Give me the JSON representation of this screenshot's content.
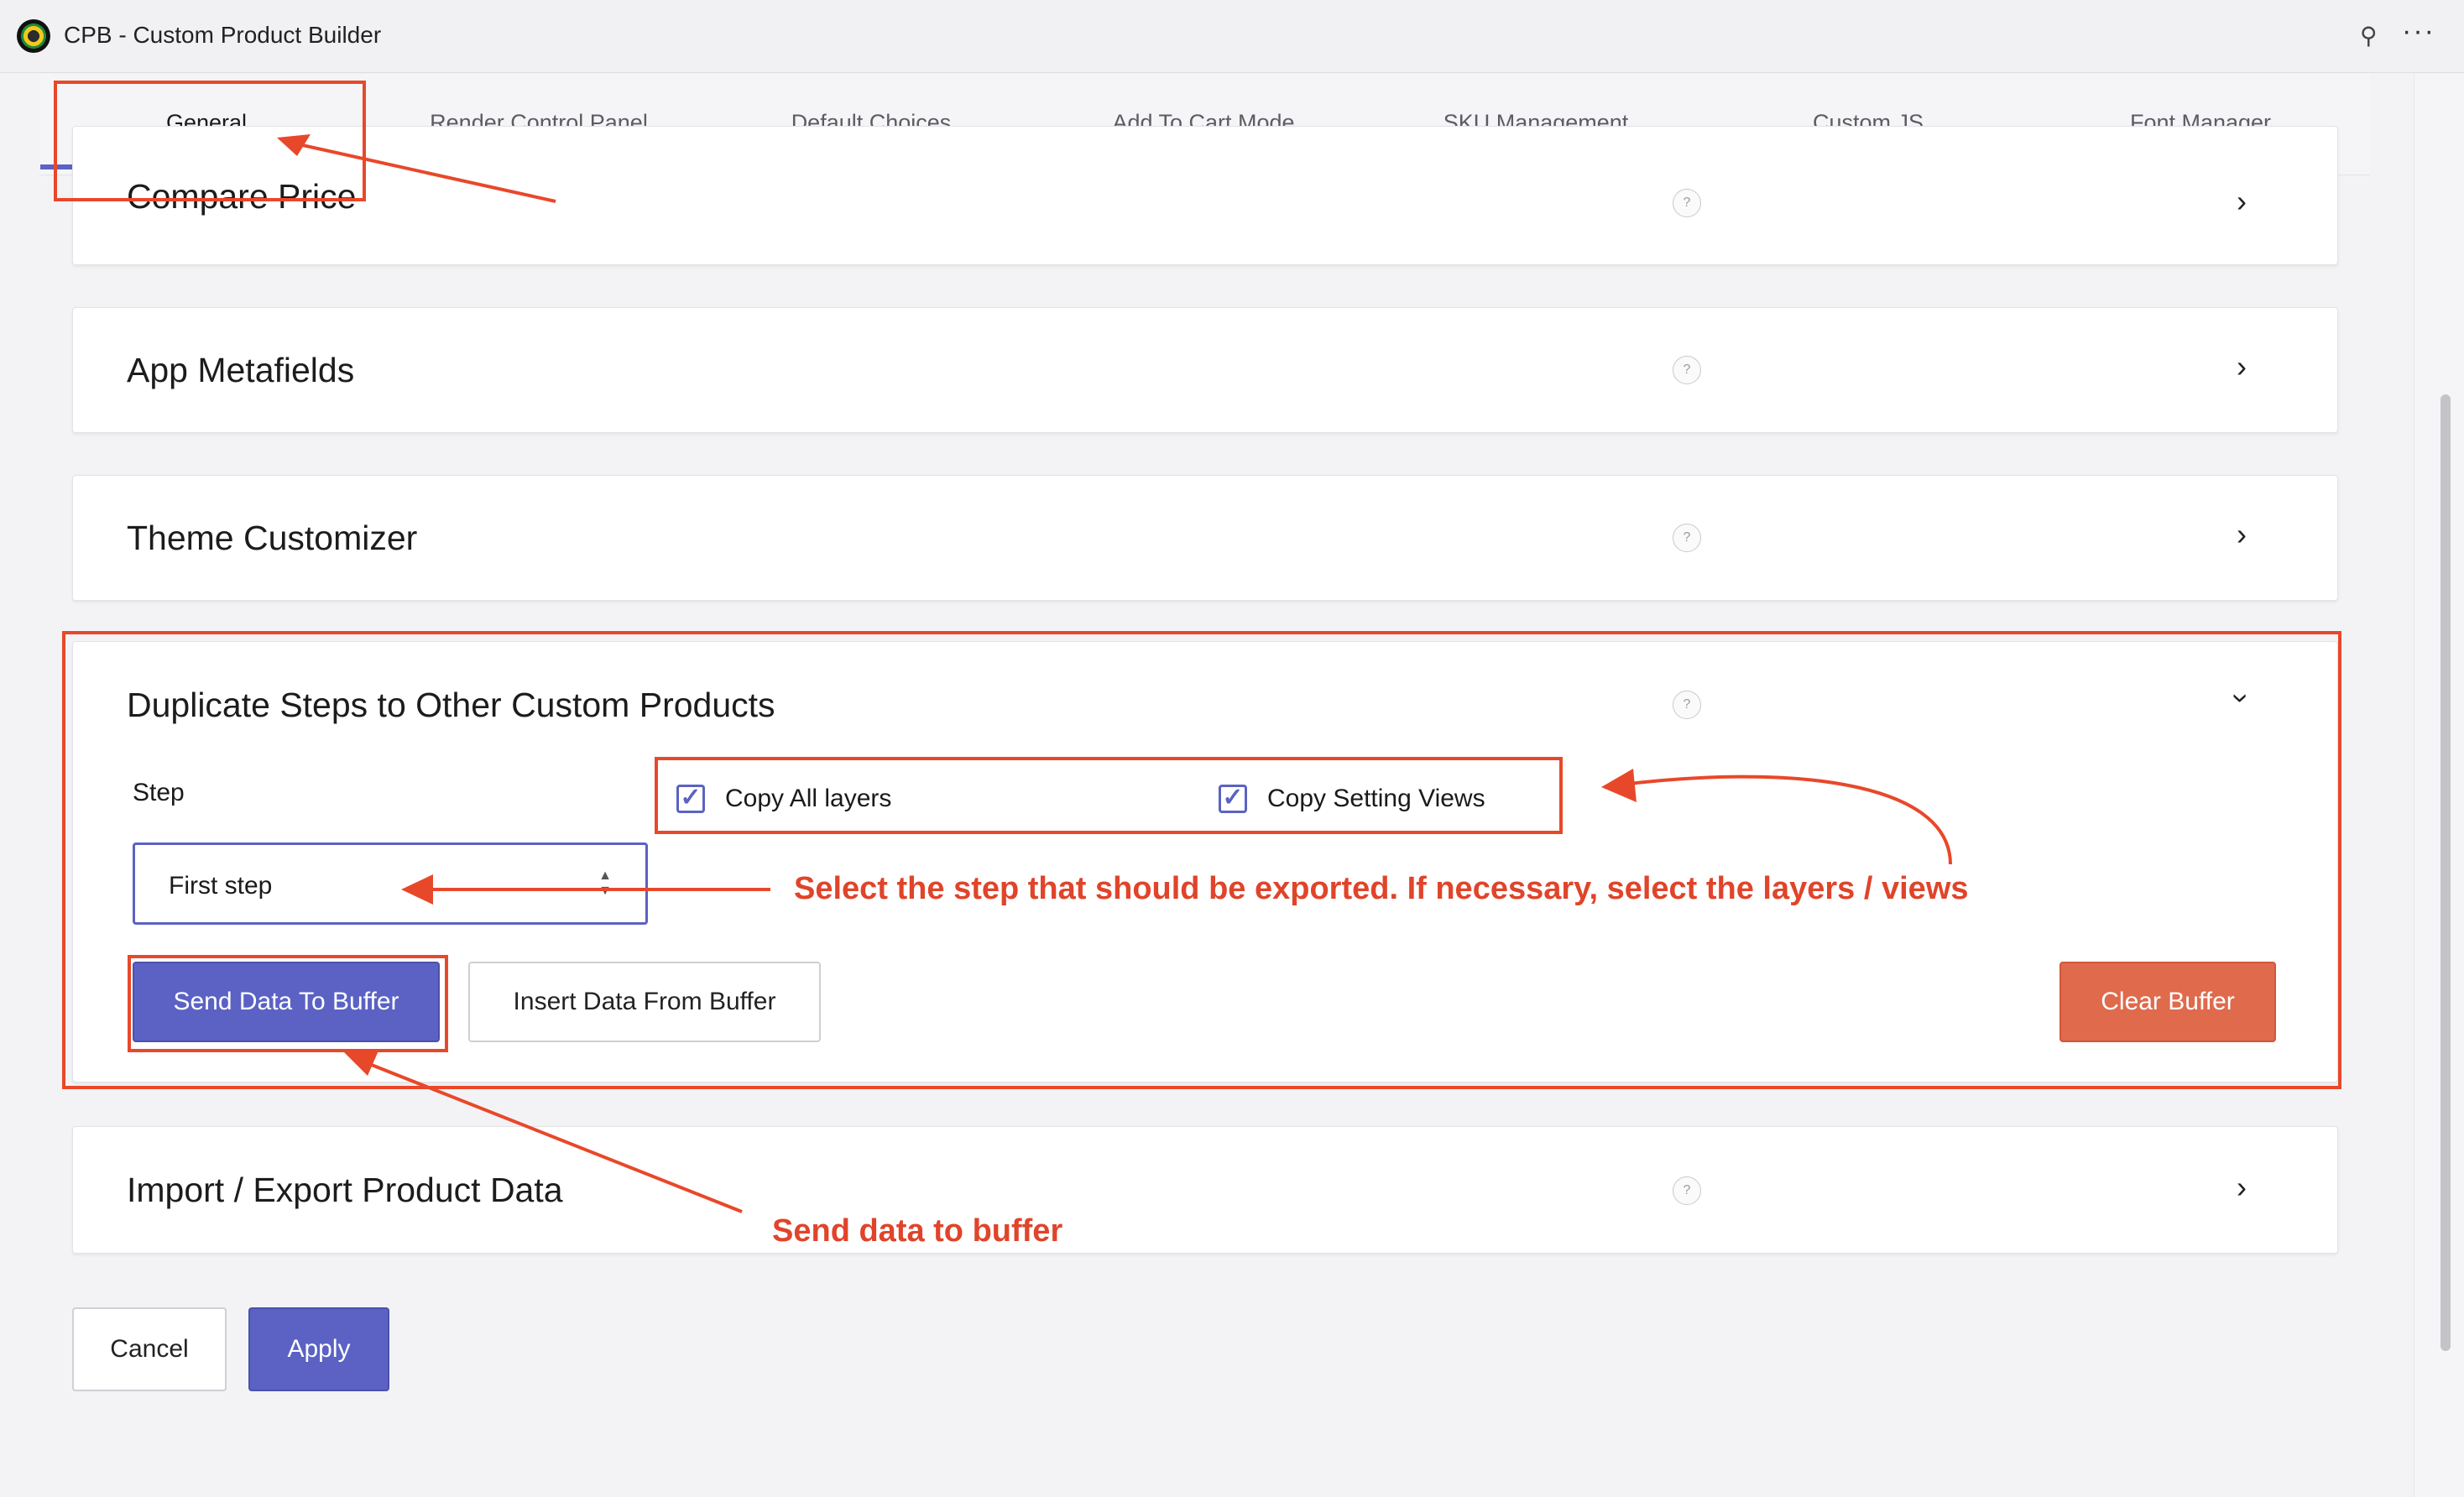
{
  "window": {
    "title": "CPB - Custom Product Builder"
  },
  "tabs": [
    {
      "label": "General",
      "active": true
    },
    {
      "label": "Render Control Panel"
    },
    {
      "label": "Default Choices"
    },
    {
      "label": "Add To Cart Mode"
    },
    {
      "label": "SKU Management"
    },
    {
      "label": "Custom JS"
    },
    {
      "label": "Font Manager"
    }
  ],
  "sections": {
    "compare_price": {
      "title": "Compare Price",
      "help": "?"
    },
    "app_metafields": {
      "title": "App Metafields",
      "help": "?"
    },
    "theme_customizer": {
      "title": "Theme Customizer",
      "help": "?"
    },
    "duplicate_steps": {
      "title": "Duplicate Steps to Other Custom Products",
      "help": "?",
      "step_label": "Step",
      "step_value": "First step",
      "copy_all_layers": {
        "label": "Copy All layers",
        "checked": true
      },
      "copy_setting_views": {
        "label": "Copy Setting Views",
        "checked": true
      },
      "send_button": "Send Data To Buffer",
      "insert_button": "Insert Data From Buffer",
      "clear_button": "Clear Buffer"
    },
    "import_export": {
      "title": "Import / Export Product Data",
      "help": "?"
    }
  },
  "footer": {
    "cancel": "Cancel",
    "apply": "Apply"
  },
  "annotations": {
    "select_note": "Select the step that should be exported. If necessary, select the layers / views",
    "send_note": "Send data to buffer"
  },
  "colors": {
    "accent": "#5b62c4",
    "danger": "#df6a4c",
    "annotation": "#e8482a"
  },
  "icons": [
    "app-logo-icon",
    "pin-icon",
    "more-icon",
    "help-icon",
    "chevron-right-icon",
    "chevron-down-icon",
    "checkbox-icon"
  ]
}
